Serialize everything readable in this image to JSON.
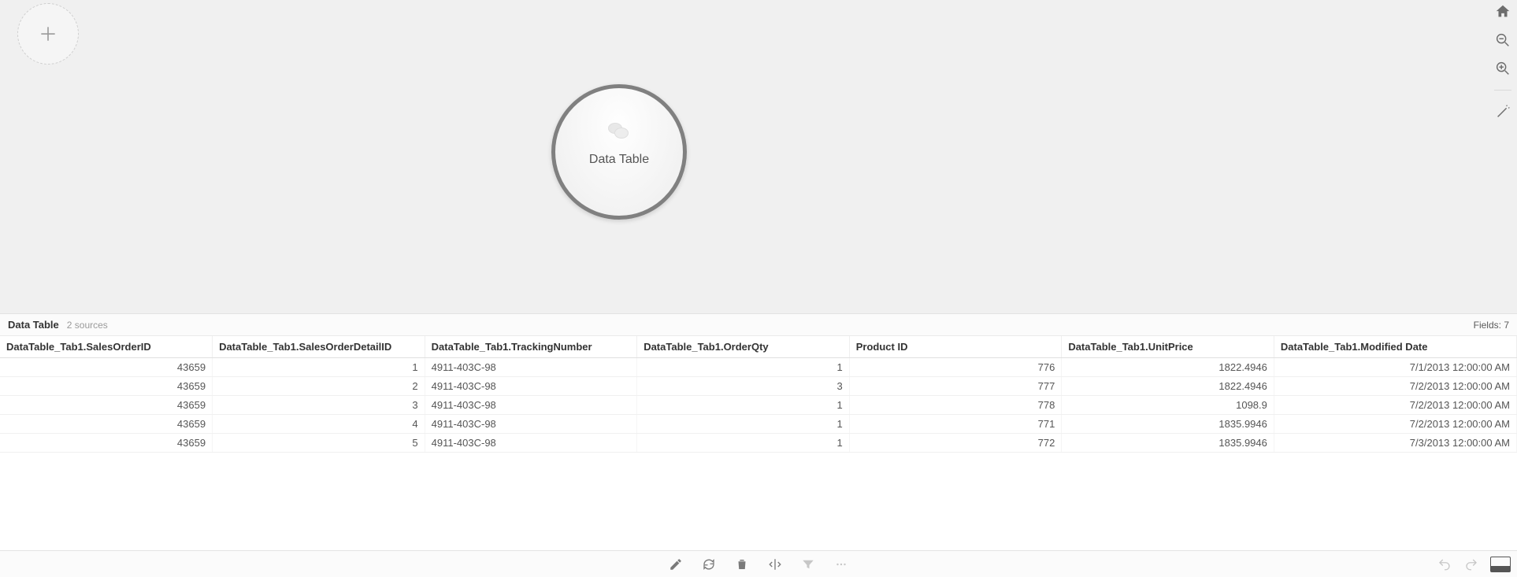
{
  "canvas": {
    "data_bubble_label": "Data Table"
  },
  "grid": {
    "title": "Data Table",
    "sources_label": "2 sources",
    "fields_label": "Fields: 7",
    "columns": [
      "DataTable_Tab1.SalesOrderID",
      "DataTable_Tab1.SalesOrderDetailID",
      "DataTable_Tab1.TrackingNumber",
      "DataTable_Tab1.OrderQty",
      "Product ID",
      "DataTable_Tab1.UnitPrice",
      "DataTable_Tab1.Modified Date"
    ],
    "column_align": [
      "num",
      "num",
      "txt",
      "num",
      "num",
      "num",
      "txt-right"
    ],
    "rows": [
      [
        "43659",
        "1",
        "4911-403C-98",
        "1",
        "776",
        "1822.4946",
        "7/1/2013 12:00:00 AM"
      ],
      [
        "43659",
        "2",
        "4911-403C-98",
        "3",
        "777",
        "1822.4946",
        "7/2/2013 12:00:00 AM"
      ],
      [
        "43659",
        "3",
        "4911-403C-98",
        "1",
        "778",
        "1098.9",
        "7/2/2013 12:00:00 AM"
      ],
      [
        "43659",
        "4",
        "4911-403C-98",
        "1",
        "771",
        "1835.9946",
        "7/2/2013 12:00:00 AM"
      ],
      [
        "43659",
        "5",
        "4911-403C-98",
        "1",
        "772",
        "1835.9946",
        "7/3/2013 12:00:00 AM"
      ]
    ]
  }
}
